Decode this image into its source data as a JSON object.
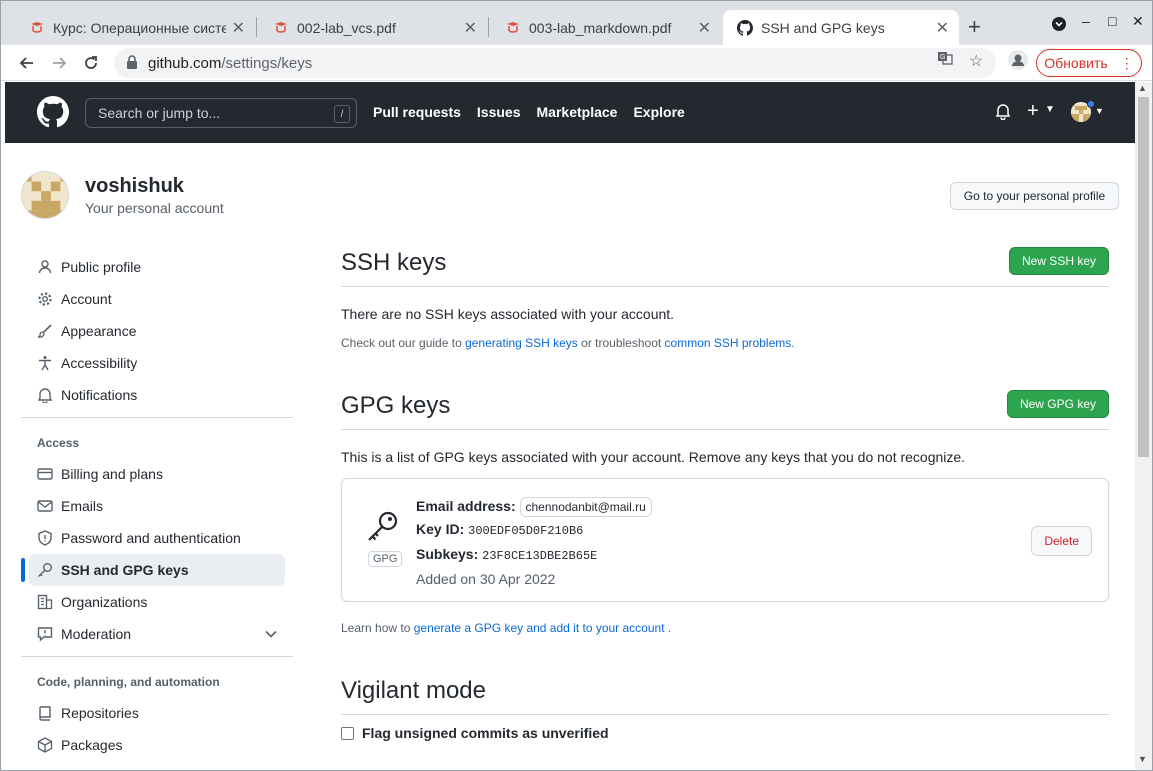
{
  "browser": {
    "tabs": [
      {
        "title": "Курс: Операционные системы",
        "icon": "moodle-icon"
      },
      {
        "title": "002-lab_vcs.pdf",
        "icon": "pdf-icon"
      },
      {
        "title": "003-lab_markdown.pdf",
        "icon": "pdf-icon"
      },
      {
        "title": "SSH and GPG keys",
        "icon": "github-icon"
      }
    ],
    "url_host": "github.com",
    "url_path": "/settings/keys",
    "update_label": "Обновить"
  },
  "header": {
    "search_placeholder": "Search or jump to...",
    "search_shortcut": "/",
    "nav": [
      "Pull requests",
      "Issues",
      "Marketplace",
      "Explore"
    ]
  },
  "account": {
    "username": "voshishuk",
    "subtitle": "Your personal account",
    "profile_button": "Go to your personal profile"
  },
  "sidebar": {
    "items": [
      {
        "label": "Public profile",
        "icon": "person-icon"
      },
      {
        "label": "Account",
        "icon": "gear-icon"
      },
      {
        "label": "Appearance",
        "icon": "paintbrush-icon"
      },
      {
        "label": "Accessibility",
        "icon": "accessibility-icon"
      },
      {
        "label": "Notifications",
        "icon": "bell-icon"
      }
    ],
    "access_heading": "Access",
    "access_items": [
      {
        "label": "Billing and plans",
        "icon": "credit-card-icon"
      },
      {
        "label": "Emails",
        "icon": "mail-icon"
      },
      {
        "label": "Password and authentication",
        "icon": "shield-icon"
      },
      {
        "label": "SSH and GPG keys",
        "icon": "key-icon",
        "selected": true
      },
      {
        "label": "Organizations",
        "icon": "organization-icon"
      },
      {
        "label": "Moderation",
        "icon": "report-icon"
      }
    ],
    "code_heading": "Code, planning, and automation",
    "code_items": [
      {
        "label": "Repositories",
        "icon": "repo-icon"
      },
      {
        "label": "Packages",
        "icon": "package-icon"
      }
    ]
  },
  "ssh": {
    "title": "SSH keys",
    "new_button": "New SSH key",
    "empty_text": "There are no SSH keys associated with your account.",
    "guide_prefix": "Check out our guide to ",
    "guide_link": "generating SSH keys",
    "guide_middle": " or troubleshoot ",
    "guide_link2": "common SSH problems",
    "guide_suffix": "."
  },
  "gpg": {
    "title": "GPG keys",
    "new_button": "New GPG key",
    "intro": "This is a list of GPG keys associated with your account. Remove any keys that you do not recognize.",
    "badge": "GPG",
    "email_label": "Email address:",
    "email": "chennodanbit@mail.ru",
    "keyid_label": "Key ID:",
    "keyid": "300EDF05D0F210B6",
    "subkeys_label": "Subkeys:",
    "subkeys": "23F8CE13DBE2B65E",
    "added": "Added on 30 Apr 2022",
    "delete_button": "Delete",
    "learn_prefix": "Learn how to ",
    "learn_link": "generate a GPG key and add it to your account",
    "learn_suffix": " ."
  },
  "vigilant": {
    "title": "Vigilant mode",
    "checkbox_label": "Flag unsigned commits as unverified"
  },
  "colors": {
    "primary_green": "#2da44e",
    "header_bg": "#24292f",
    "link": "#0969da",
    "danger": "#cf222e"
  }
}
